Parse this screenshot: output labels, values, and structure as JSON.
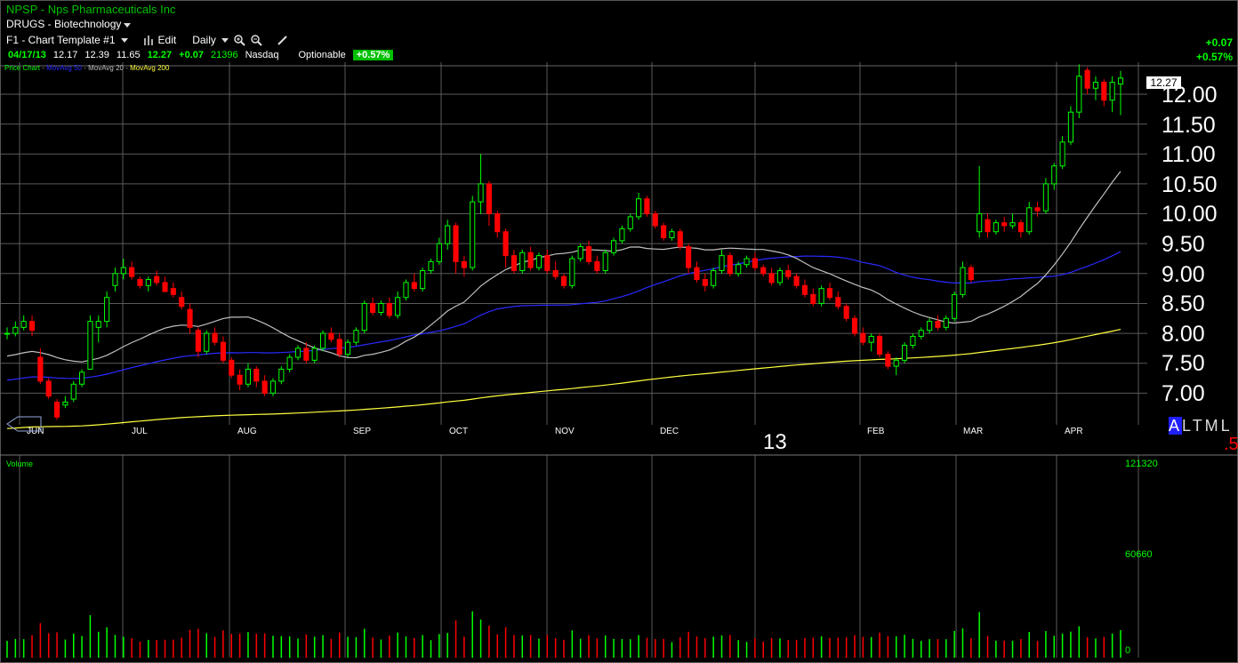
{
  "header": {
    "title": "NPSP - Nps Pharmaceuticals Inc",
    "subtitle": "DRUGS - Biotechnology"
  },
  "toolbar": {
    "template_label": "F1 - Chart Template #1",
    "edit_label": "Edit",
    "period_label": "Daily"
  },
  "quote": {
    "date": "04/17/13",
    "open": "12.17",
    "high": "12.39",
    "low": "11.65",
    "last": "12.27",
    "change": "+0.07",
    "volume": "21396",
    "exchange": "Nasdaq",
    "optionable": "Optionable",
    "pct_badge": "+0.57%"
  },
  "change_box": {
    "change": "+0.07",
    "pct": "+0.57%"
  },
  "legend": {
    "price": "Price Chart",
    "ma50": "MovAvg 50",
    "ma20": "MovAvg 20",
    "ma200": "MovAvg 200"
  },
  "price_axis": {
    "current": "12.27",
    "labels": [
      "12.00",
      "11.50",
      "11.00",
      "10.50",
      "10.00",
      "9.50",
      "9.00",
      "8.50",
      "8.00",
      "7.50",
      "7.00"
    ]
  },
  "months": [
    "JUN",
    "JUL",
    "AUG",
    "SEP",
    "OCT",
    "NOV",
    "DEC",
    "FEB",
    "MAR",
    "APR"
  ],
  "year_label": "13",
  "timeframe": {
    "a": "A",
    "rest": "LTML"
  },
  "bottom_right_value": ".5",
  "volume_panel": {
    "title": "Volume",
    "labels": [
      "121320",
      "60660",
      "0"
    ]
  },
  "colors": {
    "up": "#00ff00",
    "down": "#ff0000",
    "ma20": "#c0c0c0",
    "ma50": "#2a2aff",
    "ma200": "#ffff40",
    "grid": "#5a5a5a"
  },
  "chart_data": {
    "type": "candlestick",
    "xlabel": "",
    "ylabel": "",
    "ylim": [
      6.9,
      12.5
    ],
    "volume_max": 121320,
    "series": [
      {
        "name": "Price Chart",
        "ohlc_points": [
          [
            8.0,
            8.1,
            7.9,
            8.0
          ],
          [
            8.0,
            8.2,
            7.95,
            8.1
          ],
          [
            8.1,
            8.3,
            8.05,
            8.2
          ],
          [
            8.2,
            8.3,
            7.95,
            8.05
          ],
          [
            7.6,
            7.75,
            7.15,
            7.2
          ],
          [
            7.2,
            7.25,
            6.9,
            6.95
          ],
          [
            6.85,
            6.9,
            6.55,
            6.6
          ],
          [
            6.8,
            6.95,
            6.75,
            6.85
          ],
          [
            6.9,
            7.2,
            6.85,
            7.15
          ],
          [
            7.15,
            7.4,
            7.1,
            7.35
          ],
          [
            7.4,
            8.3,
            7.4,
            8.2
          ],
          [
            8.1,
            8.3,
            7.85,
            8.2
          ],
          [
            8.2,
            8.7,
            8.1,
            8.6
          ],
          [
            8.8,
            9.1,
            8.7,
            9.0
          ],
          [
            9.0,
            9.25,
            8.9,
            9.1
          ],
          [
            9.1,
            9.2,
            8.9,
            8.95
          ],
          [
            8.9,
            8.95,
            8.75,
            8.8
          ],
          [
            8.8,
            8.95,
            8.7,
            8.9
          ],
          [
            8.95,
            9.05,
            8.8,
            8.85
          ],
          [
            8.85,
            8.95,
            8.7,
            8.7
          ],
          [
            8.75,
            8.85,
            8.6,
            8.65
          ],
          [
            8.6,
            8.7,
            8.4,
            8.45
          ],
          [
            8.4,
            8.5,
            8.0,
            8.1
          ],
          [
            8.05,
            8.1,
            7.6,
            7.7
          ],
          [
            7.7,
            8.05,
            7.65,
            8.0
          ],
          [
            8.0,
            8.1,
            7.8,
            7.85
          ],
          [
            7.85,
            7.95,
            7.5,
            7.55
          ],
          [
            7.55,
            7.6,
            7.25,
            7.3
          ],
          [
            7.3,
            7.4,
            7.05,
            7.15
          ],
          [
            7.15,
            7.5,
            7.1,
            7.4
          ],
          [
            7.4,
            7.45,
            7.1,
            7.2
          ],
          [
            7.2,
            7.3,
            6.95,
            7.0
          ],
          [
            7.0,
            7.25,
            6.95,
            7.2
          ],
          [
            7.2,
            7.45,
            7.15,
            7.4
          ],
          [
            7.4,
            7.65,
            7.35,
            7.6
          ],
          [
            7.6,
            7.8,
            7.55,
            7.75
          ],
          [
            7.75,
            7.85,
            7.5,
            7.55
          ],
          [
            7.55,
            7.8,
            7.5,
            7.75
          ],
          [
            7.75,
            8.05,
            7.7,
            8.0
          ],
          [
            8.0,
            8.1,
            7.85,
            7.9
          ],
          [
            7.9,
            8.0,
            7.6,
            7.65
          ],
          [
            7.65,
            7.9,
            7.6,
            7.85
          ],
          [
            7.85,
            8.1,
            7.8,
            8.05
          ],
          [
            8.05,
            8.55,
            8.0,
            8.5
          ],
          [
            8.5,
            8.6,
            8.3,
            8.35
          ],
          [
            8.35,
            8.55,
            8.3,
            8.5
          ],
          [
            8.5,
            8.6,
            8.25,
            8.3
          ],
          [
            8.3,
            8.7,
            8.25,
            8.6
          ],
          [
            8.6,
            8.9,
            8.55,
            8.85
          ],
          [
            8.85,
            9.0,
            8.7,
            8.75
          ],
          [
            8.75,
            9.1,
            8.7,
            9.05
          ],
          [
            9.05,
            9.25,
            9.0,
            9.2
          ],
          [
            9.2,
            9.6,
            9.15,
            9.5
          ],
          [
            9.5,
            9.9,
            9.4,
            9.8
          ],
          [
            9.8,
            9.85,
            9.0,
            9.2
          ],
          [
            9.2,
            9.3,
            8.95,
            9.1
          ],
          [
            9.1,
            10.3,
            9.05,
            10.2
          ],
          [
            10.2,
            11.0,
            10.0,
            10.5
          ],
          [
            10.5,
            10.55,
            9.8,
            10.0
          ],
          [
            10.0,
            10.05,
            9.6,
            9.7
          ],
          [
            9.7,
            9.75,
            9.1,
            9.3
          ],
          [
            9.3,
            9.4,
            9.0,
            9.05
          ],
          [
            9.05,
            9.4,
            9.0,
            9.35
          ],
          [
            9.35,
            9.45,
            9.05,
            9.1
          ],
          [
            9.1,
            9.35,
            9.05,
            9.3
          ],
          [
            9.3,
            9.4,
            9.0,
            9.05
          ],
          [
            9.05,
            9.2,
            8.9,
            8.95
          ],
          [
            8.95,
            9.0,
            8.75,
            8.8
          ],
          [
            8.8,
            9.3,
            8.75,
            9.25
          ],
          [
            9.25,
            9.5,
            9.2,
            9.45
          ],
          [
            9.45,
            9.55,
            9.15,
            9.2
          ],
          [
            9.2,
            9.3,
            9.0,
            9.05
          ],
          [
            9.05,
            9.4,
            9.0,
            9.35
          ],
          [
            9.35,
            9.6,
            9.3,
            9.55
          ],
          [
            9.55,
            9.8,
            9.5,
            9.75
          ],
          [
            9.75,
            10.0,
            9.7,
            9.95
          ],
          [
            9.95,
            10.35,
            9.9,
            10.25
          ],
          [
            10.25,
            10.3,
            9.95,
            10.0
          ],
          [
            10.0,
            10.05,
            9.75,
            9.8
          ],
          [
            9.8,
            9.85,
            9.55,
            9.6
          ],
          [
            9.6,
            9.75,
            9.55,
            9.7
          ],
          [
            9.7,
            9.75,
            9.4,
            9.45
          ],
          [
            9.45,
            9.5,
            9.0,
            9.1
          ],
          [
            9.1,
            9.2,
            8.85,
            8.9
          ],
          [
            8.9,
            9.0,
            8.7,
            8.8
          ],
          [
            8.8,
            9.1,
            8.75,
            9.05
          ],
          [
            9.05,
            9.4,
            9.0,
            9.3
          ],
          [
            9.3,
            9.35,
            8.95,
            9.0
          ],
          [
            9.0,
            9.2,
            8.95,
            9.15
          ],
          [
            9.15,
            9.3,
            9.1,
            9.25
          ],
          [
            9.25,
            9.35,
            9.05,
            9.1
          ],
          [
            9.1,
            9.15,
            8.95,
            9.0
          ],
          [
            9.0,
            9.1,
            8.8,
            8.85
          ],
          [
            8.85,
            9.1,
            8.8,
            9.05
          ],
          [
            9.05,
            9.15,
            8.9,
            8.95
          ],
          [
            8.95,
            9.0,
            8.75,
            8.8
          ],
          [
            8.8,
            8.9,
            8.6,
            8.65
          ],
          [
            8.65,
            8.75,
            8.45,
            8.5
          ],
          [
            8.5,
            8.8,
            8.45,
            8.75
          ],
          [
            8.75,
            8.85,
            8.55,
            8.6
          ],
          [
            8.6,
            8.7,
            8.4,
            8.45
          ],
          [
            8.45,
            8.5,
            8.2,
            8.25
          ],
          [
            8.25,
            8.3,
            7.95,
            8.0
          ],
          [
            8.0,
            8.1,
            7.8,
            7.85
          ],
          [
            7.85,
            8.0,
            7.7,
            7.95
          ],
          [
            7.95,
            8.0,
            7.6,
            7.65
          ],
          [
            7.65,
            7.7,
            7.4,
            7.45
          ],
          [
            7.45,
            7.6,
            7.3,
            7.55
          ],
          [
            7.55,
            7.85,
            7.5,
            7.8
          ],
          [
            7.8,
            8.0,
            7.75,
            7.95
          ],
          [
            7.95,
            8.1,
            7.9,
            8.05
          ],
          [
            8.05,
            8.25,
            8.0,
            8.2
          ],
          [
            8.2,
            8.3,
            8.05,
            8.1
          ],
          [
            8.1,
            8.3,
            8.05,
            8.25
          ],
          [
            8.25,
            8.7,
            8.2,
            8.65
          ],
          [
            8.65,
            9.2,
            8.6,
            9.1
          ],
          [
            9.1,
            9.15,
            8.85,
            8.9
          ],
          [
            9.7,
            10.8,
            9.6,
            10.0
          ],
          [
            9.9,
            10.0,
            9.6,
            9.7
          ],
          [
            9.7,
            9.9,
            9.65,
            9.85
          ],
          [
            9.85,
            9.95,
            9.7,
            9.8
          ],
          [
            9.8,
            10.0,
            9.75,
            9.85
          ],
          [
            9.85,
            9.9,
            9.6,
            9.7
          ],
          [
            9.7,
            10.2,
            9.65,
            10.1
          ],
          [
            10.1,
            10.2,
            9.95,
            10.05
          ],
          [
            10.05,
            10.6,
            10.0,
            10.5
          ],
          [
            10.5,
            10.85,
            10.4,
            10.8
          ],
          [
            10.8,
            11.3,
            10.75,
            11.2
          ],
          [
            11.2,
            11.8,
            11.15,
            11.7
          ],
          [
            11.7,
            12.5,
            11.6,
            12.3
          ],
          [
            12.4,
            12.45,
            12.0,
            12.1
          ],
          [
            12.1,
            12.3,
            11.9,
            12.2
          ],
          [
            12.2,
            12.25,
            11.8,
            11.9
          ],
          [
            11.9,
            12.3,
            11.7,
            12.2
          ],
          [
            12.17,
            12.39,
            11.65,
            12.27
          ]
        ]
      }
    ]
  }
}
